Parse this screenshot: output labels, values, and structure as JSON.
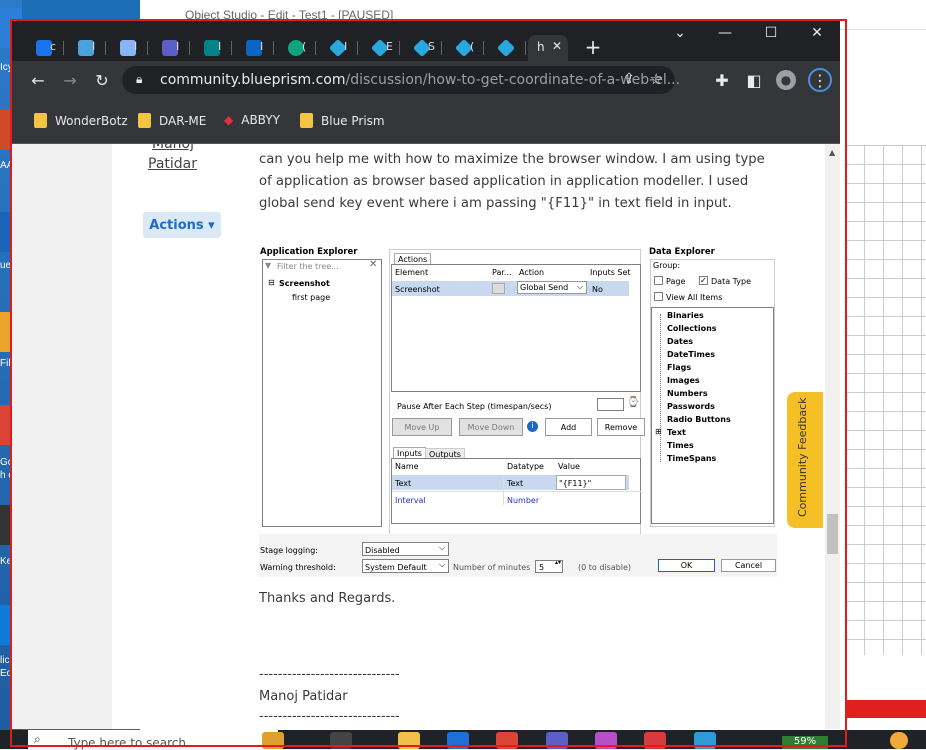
{
  "background": {
    "window_title": "Object Studio - Edit - Test1 - [PAUSED]",
    "desktop_labels": [
      "Icy",
      "AA",
      "ue l",
      "File",
      "Goo",
      "h c",
      "Keel",
      "licro",
      "Ed"
    ]
  },
  "browser": {
    "tabs": [
      {
        "label": "c",
        "icon": "blueprism-icon",
        "color": "#1a73e8"
      },
      {
        "label": "I",
        "icon": "people-icon",
        "color": "#4aa3df"
      },
      {
        "label": "I",
        "icon": "lock-icon",
        "color": "#8ab4f8"
      },
      {
        "label": "I",
        "icon": "teams-icon",
        "color": "#5b5fc7"
      },
      {
        "label": "I",
        "icon": "sharepoint-icon",
        "color": "#038387"
      },
      {
        "label": "I",
        "icon": "linkedin-icon",
        "color": "#0a66c2"
      },
      {
        "label": "(",
        "icon": "openai-icon",
        "color": "#10a37f"
      },
      {
        "label": "I",
        "icon": "blueprism-icon",
        "color": "#29a8e0"
      },
      {
        "label": "E",
        "icon": "blueprism-icon",
        "color": "#29a8e0"
      },
      {
        "label": "S",
        "icon": "blueprism-icon",
        "color": "#29a8e0"
      },
      {
        "label": "(",
        "icon": "blueprism-icon",
        "color": "#29a8e0"
      },
      {
        "label": "",
        "icon": "blueprism-icon",
        "color": "#29a8e0"
      },
      {
        "label": "h",
        "icon": "close-icon",
        "color": "#35363a"
      }
    ],
    "new_tab": "+",
    "url_host": "community.blueprism.com",
    "url_path": "/discussion/how-to-get-coordinate-of-a-web-el...",
    "bookmarks": [
      "WonderBotz",
      "DAR-ME",
      "ABBYY",
      "Blue Prism"
    ]
  },
  "post": {
    "author_first": "Manoj",
    "author_last": "Patidar",
    "actions_label": "Actions",
    "body": "can you help me with how to maximize the browser window. I am using type of application as browser based application in application modeller. I used global send key event where i am passing \"{F11}\" in text field in input.",
    "thanks": "Thanks and Regards.",
    "divider": "------------------------------",
    "signature": "Manoj Patidar",
    "feedback_label": "Community Feedback"
  },
  "screenshot": {
    "app_explorer_title": "Application Explorer",
    "filter_placeholder": "Filter the tree...",
    "tree_root": "Screenshot",
    "tree_child": "first page",
    "actions_tab": "Actions",
    "actions_headers": [
      "Element",
      "Par...",
      "Action",
      "Inputs Set"
    ],
    "actions_row": [
      "Screenshot",
      "",
      "Global Send",
      "No"
    ],
    "pause_label": "Pause After Each Step (timespan/secs)",
    "buttons": [
      "Move Up",
      "Move Down",
      "Add",
      "Remove"
    ],
    "io_tabs": [
      "Inputs",
      "Outputs"
    ],
    "io_headers": [
      "Name",
      "Datatype",
      "Value"
    ],
    "io_rows": [
      [
        "Text",
        "Text",
        "\"{F11}\""
      ],
      [
        "Interval",
        "Number",
        ""
      ]
    ],
    "data_explorer_title": "Data Explorer",
    "group_label": "Group:",
    "checks": [
      "Page",
      "Data Type",
      "View All Items"
    ],
    "data_types": [
      "Binaries",
      "Collections",
      "Dates",
      "DateTimes",
      "Flags",
      "Images",
      "Numbers",
      "Passwords",
      "Radio Buttons",
      "Text",
      "Times",
      "TimeSpans"
    ],
    "stage_logging_label": "Stage logging:",
    "stage_logging_value": "Disabled",
    "warning_label": "Warning threshold:",
    "warning_value": "System Default",
    "minutes_label": "Number of minutes",
    "minutes_value": "5",
    "disable_hint": "(0 to disable)",
    "ok": "OK",
    "cancel": "Cancel"
  },
  "taskbar": {
    "search_placeholder": "Type here to search",
    "battery": "59%"
  }
}
